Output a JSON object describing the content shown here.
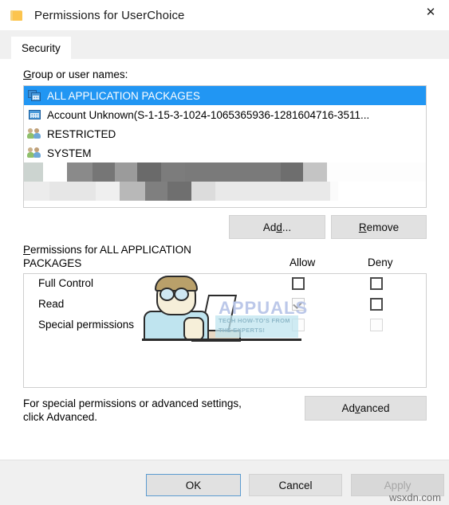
{
  "window": {
    "title": "Permissions for UserChoice",
    "icon": "folder-icon",
    "close_label": "✕"
  },
  "tabs": [
    {
      "label": "Security",
      "active": true
    }
  ],
  "group_list": {
    "label": "Group or user names:",
    "label_accesskey": "G",
    "rows": [
      {
        "name": "ALL APPLICATION PACKAGES",
        "icon": "app-package-icon",
        "selected": true
      },
      {
        "name": "Account Unknown(S-1-15-3-1024-1065365936-1281604716-3511...",
        "icon": "app-package-icon",
        "selected": false
      },
      {
        "name": "RESTRICTED",
        "icon": "user-group-icon",
        "selected": false
      },
      {
        "name": "SYSTEM",
        "icon": "user-group-icon",
        "selected": false
      }
    ],
    "redacted_rows": 2
  },
  "list_buttons": {
    "add": "Add...",
    "add_accesskey": "d",
    "remove": "Remove",
    "remove_accesskey": "R"
  },
  "permissions": {
    "label": "Permissions for ALL APPLICATION PACKAGES",
    "label_accesskey": "P",
    "columns": {
      "allow": "Allow",
      "deny": "Deny"
    },
    "rows": [
      {
        "name": "Full Control",
        "allow": "unchecked",
        "deny": "unchecked"
      },
      {
        "name": "Read",
        "allow": "checked-disabled",
        "deny": "unchecked"
      },
      {
        "name": "Special permissions",
        "allow": "disabled",
        "deny": "disabled"
      }
    ]
  },
  "advanced": {
    "hint_line1": "For special permissions or advanced settings,",
    "hint_line2": "click Advanced.",
    "button": "Advanced",
    "button_accesskey": "v"
  },
  "footer": {
    "ok": "OK",
    "cancel": "Cancel",
    "apply": "Apply",
    "apply_disabled": true
  },
  "watermarks": {
    "brand": "APPUALS",
    "brand_tagline_line1": "TECH HOW-TO'S FROM",
    "brand_tagline_line2": "THE EXPERTS!",
    "site": "wsxdn.com"
  },
  "colors": {
    "selection_blue": "#2196f3",
    "dialog_bg": "#ffffff",
    "panel_bg": "#f0f0f0",
    "button_face": "#e1e1e1",
    "default_button_border": "#5b9bd0"
  }
}
